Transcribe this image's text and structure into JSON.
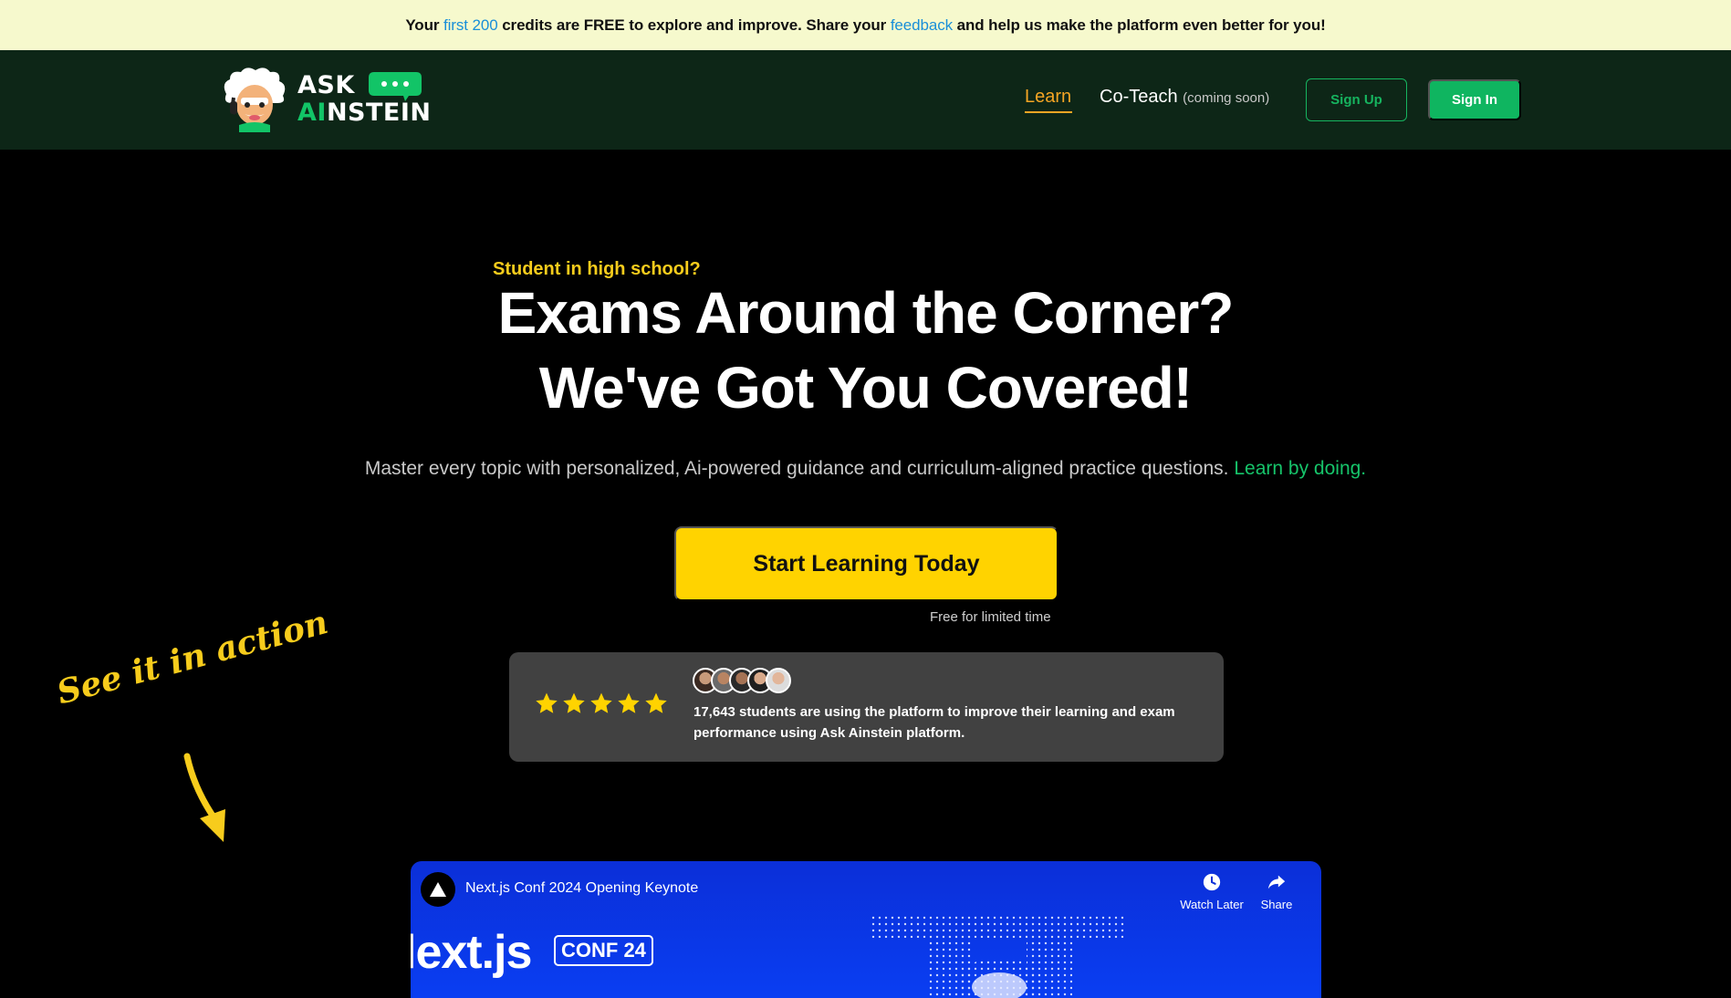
{
  "banner": {
    "prefix": "Your",
    "highlight1": "first 200",
    "middle": "credits are FREE to explore and improve. Share your",
    "highlight2": "feedback",
    "suffix": "and help us make the platform even better for you!"
  },
  "nav": {
    "logo_ask": "ASK",
    "logo_ai": "AI",
    "logo_stein": "NSTEIN",
    "learn": "Learn",
    "coteach": "Co-Teach",
    "coteach_note": "(coming soon)",
    "signup": "Sign Up",
    "signin": "Sign In"
  },
  "hero": {
    "eyebrow": "Student in high school?",
    "title_line1": "Exams Around the Corner?",
    "title_line2": "We've Got You Covered!",
    "subtitle": "Master every topic with personalized, Ai-powered guidance and curriculum-aligned practice questions.",
    "subtitle_highlight": "Learn by doing.",
    "cta": "Start Learning Today",
    "cta_note": "Free for limited time"
  },
  "social_proof": {
    "rating_stars": 5,
    "text": "17,643 students are using the platform to improve their learning and exam performance using Ask Ainstein platform."
  },
  "annotation": "See it in action",
  "video": {
    "title": "Next.js Conf 2024 Opening Keynote",
    "watch_later": "Watch Later",
    "share": "Share",
    "overlay_text": "lext.js",
    "badge": "CONF 24"
  },
  "colors": {
    "accent_yellow": "#ffd300",
    "brand_green": "#0fb560",
    "nav_bg": "#0d2617",
    "banner_bg": "#f6f9cd",
    "link_blue": "#1a8fd8",
    "learn_orange": "#f5a524"
  }
}
